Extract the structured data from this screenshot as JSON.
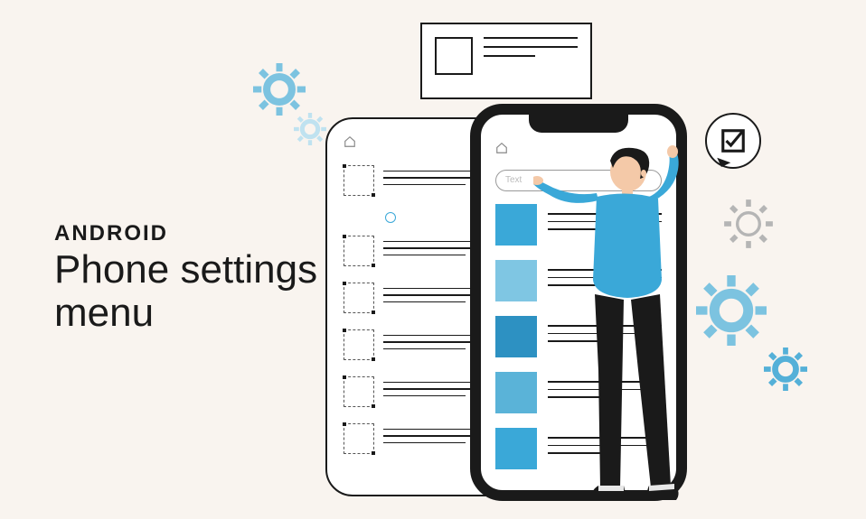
{
  "text": {
    "subtitle": "ANDROID",
    "title_line1": "Phone settings",
    "title_line2": "menu"
  },
  "phone": {
    "search_placeholder": "Text"
  },
  "colors": {
    "background": "#f9f4ef",
    "accent": "#3aa8d8",
    "dark": "#1a1a1a"
  }
}
